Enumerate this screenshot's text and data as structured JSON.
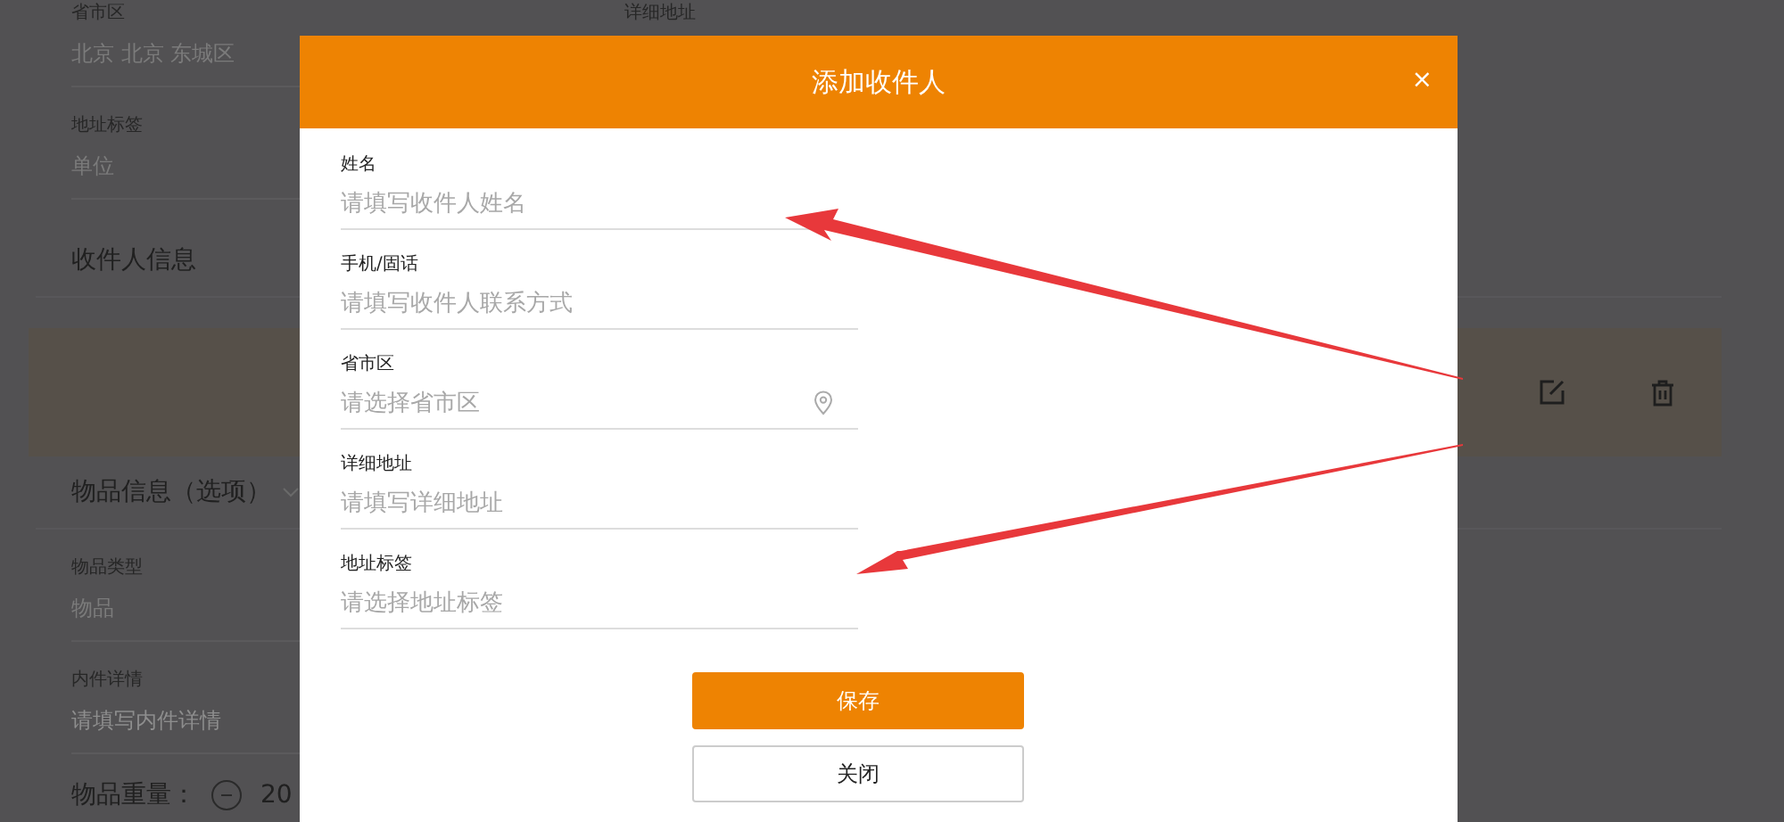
{
  "background": {
    "address_fields": [
      {
        "label": "省市区",
        "value": "北京 北京 东城区"
      },
      {
        "label": "地址标签",
        "value": "单位"
      }
    ],
    "address_right_label": "详细地址",
    "recipient_section": {
      "title": "收件人信息"
    },
    "items_section": {
      "title": "物品信息（选项）"
    },
    "item_fields": [
      {
        "label": "物品类型",
        "value": "物品",
        "kind": "value"
      },
      {
        "label": "内件详情",
        "value": "请填写内件详情",
        "kind": "placeholder"
      }
    ],
    "weight": {
      "label": "物品重量：",
      "value": "20"
    }
  },
  "dialog": {
    "title": "添加收件人",
    "close": "×",
    "fields": [
      {
        "label": "姓名",
        "placeholder": "请填写收件人姓名",
        "kind": "text"
      },
      {
        "label": "手机/固话",
        "placeholder": "请填写收件人联系方式",
        "kind": "text"
      },
      {
        "label": "省市区",
        "placeholder": "请选择省市区",
        "kind": "location"
      },
      {
        "label": "详细地址",
        "placeholder": "请填写详细地址",
        "kind": "text"
      },
      {
        "label": "地址标签",
        "placeholder": "请选择地址标签",
        "kind": "text"
      }
    ],
    "buttons": [
      {
        "label": "保存",
        "kind": "primary"
      },
      {
        "label": "关闭",
        "kind": "secondary"
      }
    ]
  }
}
